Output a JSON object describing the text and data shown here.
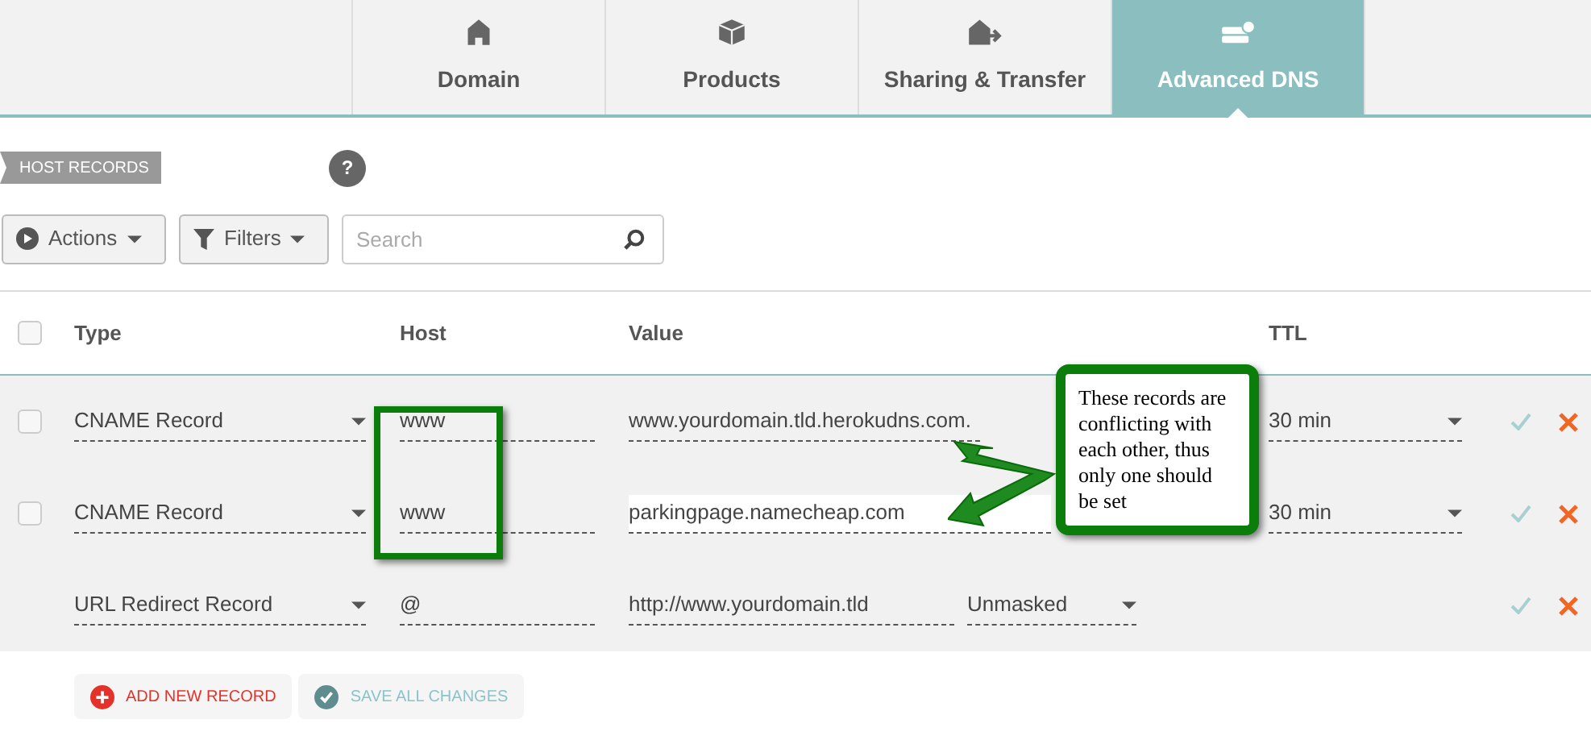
{
  "tabs": [
    {
      "label": "Domain",
      "selected": false
    },
    {
      "label": "Products",
      "selected": false
    },
    {
      "label": "Sharing & Transfer",
      "selected": false
    },
    {
      "label": "Advanced DNS",
      "selected": true
    }
  ],
  "section_label": "HOST RECORDS",
  "help_icon": "?",
  "toolbar": {
    "actions": "Actions",
    "filters": "Filters",
    "search": {
      "placeholder": "Search"
    }
  },
  "table": {
    "select_all": {
      "checked": false
    },
    "columns": [
      "Type",
      "Host",
      "Value",
      "TTL"
    ],
    "rows": [
      {
        "kind": "record",
        "checked": false,
        "type": "CNAME Record",
        "host": "www",
        "value": "www.yourdomain.tld.herokudns.com.",
        "focused": false,
        "ttl": "30 min"
      },
      {
        "kind": "record",
        "checked": false,
        "type": "CNAME Record",
        "host": "www",
        "value": "parkingpage.namecheap.com",
        "focused": true,
        "ttl": "30 min"
      },
      {
        "kind": "redirect",
        "type": "URL Redirect Record",
        "host": "@",
        "value": "http://www.yourdomain.tld",
        "focused": false,
        "mask": "Unmasked"
      }
    ]
  },
  "buttons": {
    "add": "ADD NEW RECORD",
    "save": "SAVE ALL CHANGES"
  },
  "annotation": {
    "text": "These records are conflicting with each other, thus only one should be set"
  }
}
